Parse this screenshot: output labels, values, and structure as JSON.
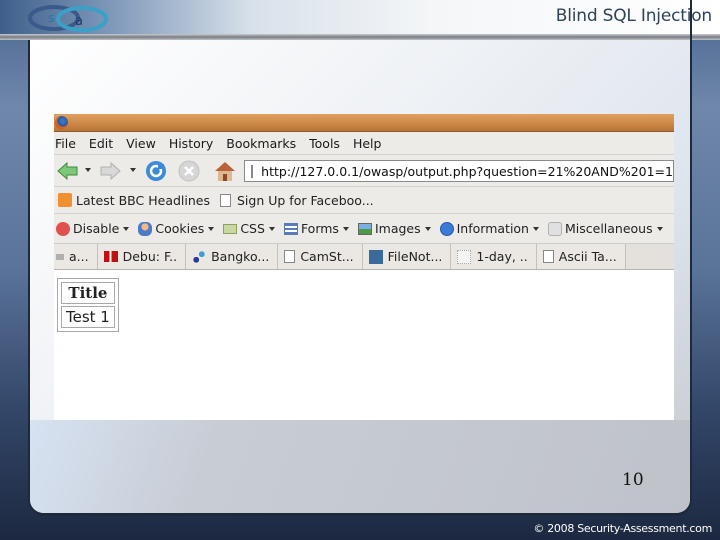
{
  "slide": {
    "title": "Blind SQL Injection",
    "page_number": "10",
    "copyright": "© 2008 Security-Assessment.com",
    "logo_text": [
      "s",
      "a"
    ]
  },
  "browser": {
    "menu": [
      "File",
      "Edit",
      "View",
      "History",
      "Bookmarks",
      "Tools",
      "Help"
    ],
    "menu_accel": [
      "F",
      "E",
      "V",
      "s",
      "B",
      "T",
      "H"
    ],
    "navigation": {
      "back_icon": "back-arrow-icon",
      "forward_icon": "forward-arrow-icon",
      "reload_icon": "reload-icon",
      "stop_icon": "stop-icon",
      "home_icon": "home-icon",
      "url": "http://127.0.0.1/owasp/output.php?question=21%20AND%201=1"
    },
    "bookmarks": [
      {
        "label": "Latest BBC Headlines",
        "icon": "rss-icon"
      },
      {
        "label": "Sign Up for Faceboo...",
        "icon": "page-icon"
      }
    ],
    "developer_toolbar": [
      {
        "label": "Disable",
        "icon": "disable-icon"
      },
      {
        "label": "Cookies",
        "icon": "cookies-icon"
      },
      {
        "label": "CSS",
        "icon": "css-icon"
      },
      {
        "label": "Forms",
        "icon": "forms-icon"
      },
      {
        "label": "Images",
        "icon": "images-icon"
      },
      {
        "label": "Information",
        "icon": "information-icon"
      },
      {
        "label": "Miscellaneous",
        "icon": "miscellaneous-icon"
      }
    ],
    "tabs": [
      {
        "label": "a...",
        "icon": "arrow-icon"
      },
      {
        "label": "Debu: F..",
        "icon": "debug-icon"
      },
      {
        "label": "Bangko...",
        "icon": "chart-icon"
      },
      {
        "label": "CamSt...",
        "icon": "page-icon"
      },
      {
        "label": "FileNot...",
        "icon": "sun-icon"
      },
      {
        "label": "1-day, ..",
        "icon": "calendar-icon"
      },
      {
        "label": "Ascii Ta...",
        "icon": "page-icon"
      }
    ],
    "page_content": {
      "table_header": "Title",
      "table_rows": [
        "Test 1"
      ]
    }
  },
  "colors": {
    "titlebar": "#cc8644",
    "slide_title": "#2e4258",
    "panel_border": "#1e2a3c"
  }
}
